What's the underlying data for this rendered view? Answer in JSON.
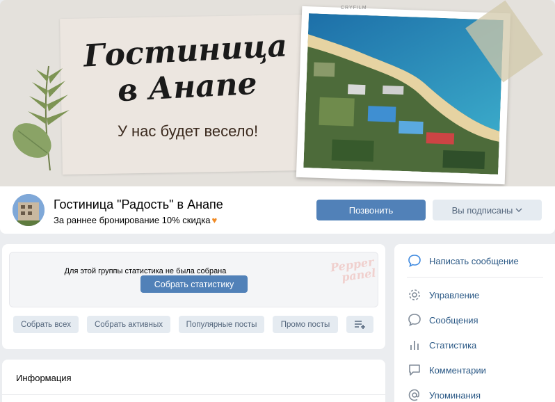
{
  "cover": {
    "title": "Гостиница в Анапе",
    "subtitle": "У нас будет весело!",
    "photo_caption": "CRYFILM"
  },
  "header": {
    "group_name": "Гостиница \"Радость\" в Анапе",
    "status": "За раннее бронирование 10% скидка",
    "call_button": "Позвонить",
    "subscribed_button": "Вы подписаны"
  },
  "stats": {
    "message": "Для этой группы статистика не была собрана",
    "collect_button": "Собрать статистику",
    "watermark_line1": "Pepper",
    "watermark_line2": "panel",
    "chips": [
      "Собрать всех",
      "Собрать активных",
      "Популярные посты",
      "Промо посты"
    ]
  },
  "info": {
    "title": "Информация"
  },
  "menu": {
    "items": [
      {
        "label": "Написать сообщение",
        "icon": "message-bubble-icon"
      },
      {
        "label": "Управление",
        "icon": "gear-icon"
      },
      {
        "label": "Сообщения",
        "icon": "chat-icon"
      },
      {
        "label": "Статистика",
        "icon": "bar-chart-icon"
      },
      {
        "label": "Комментарии",
        "icon": "comment-icon"
      },
      {
        "label": "Упоминания",
        "icon": "at-icon"
      }
    ]
  },
  "colors": {
    "accent": "#5181b8",
    "link": "#2a5885",
    "secondary_button": "#e5ebf1",
    "page_bg": "#ebedf0"
  }
}
